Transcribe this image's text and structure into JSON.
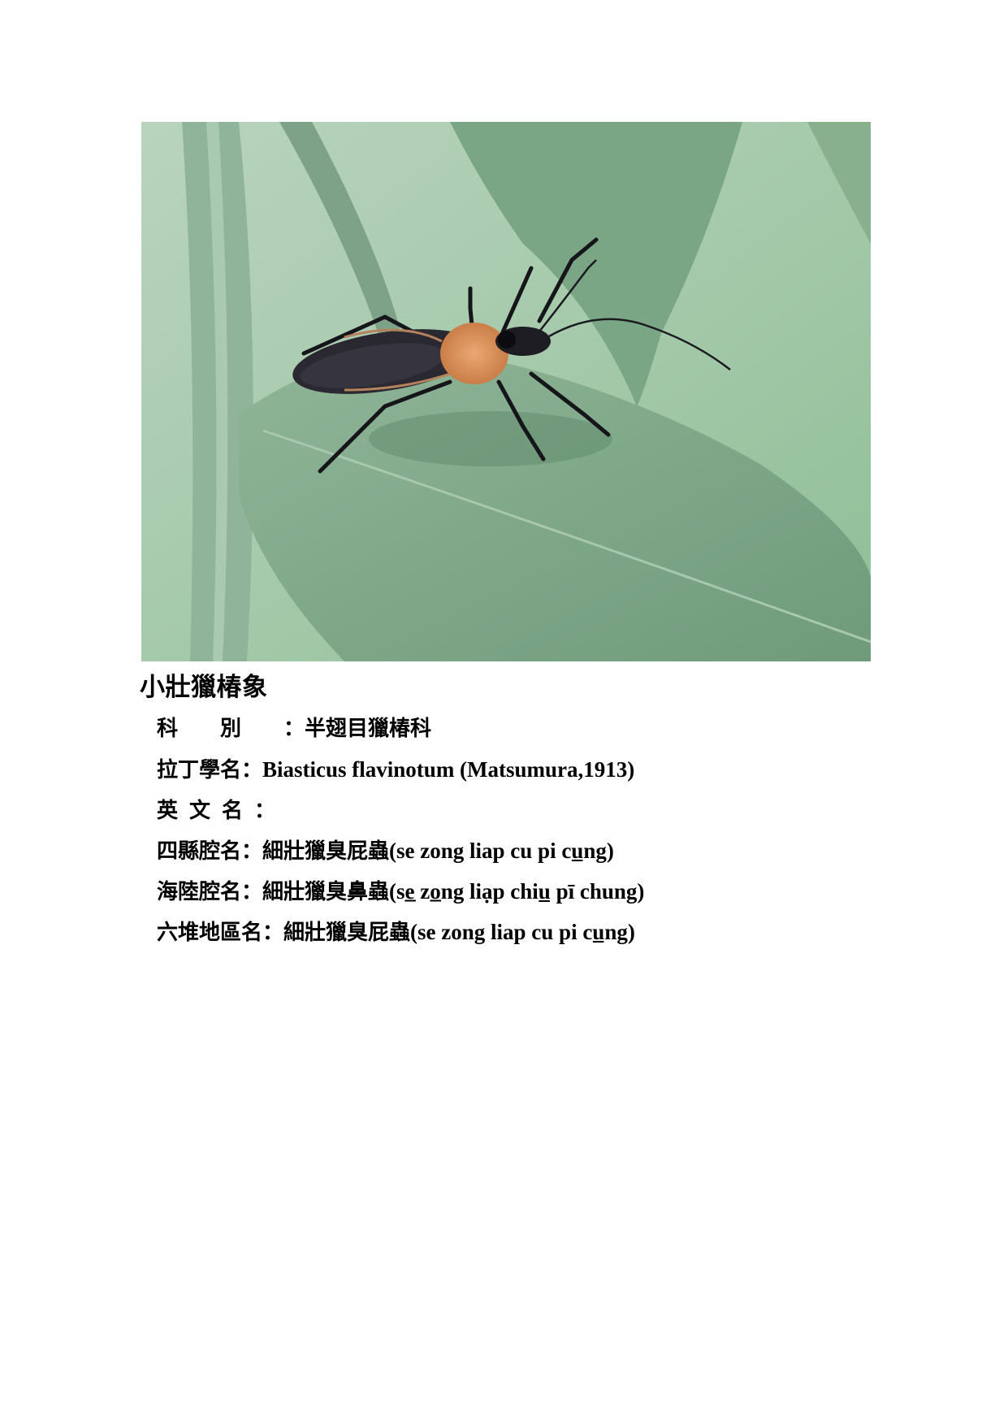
{
  "photo": {
    "icon": "assassin-bug-photo",
    "colors": {
      "background": "#a9cbb0",
      "leaf": "#7fa888",
      "bug_body": "#2a2a30",
      "pronotum": "#d9915a"
    }
  },
  "title": "小壯獵椿象",
  "rows": [
    {
      "label": "科別",
      "value_zh": "半翅目獵椿科",
      "value_latin": ""
    },
    {
      "label": "拉丁學名",
      "value_zh": "",
      "value_latin": "Biasticus flavinotum (Matsumura,1913)"
    },
    {
      "label": "英文名",
      "value_zh": "",
      "value_latin": ""
    },
    {
      "label": "四縣腔名",
      "value_zh": "細壯獵臭屁蟲",
      "value_latin": "(se zong liap cu pi cu̲ng)"
    },
    {
      "label": "海陸腔名",
      "value_zh": "細壯獵臭鼻蟲",
      "value_latin": "(se̲ zo̲ng liạp chiu̲ pī chung)"
    },
    {
      "label": "六堆地區名",
      "value_zh": "細壯獵臭屁蟲",
      "value_latin": "(se zong liap cu pi cu̲ng)"
    }
  ],
  "colon": "："
}
